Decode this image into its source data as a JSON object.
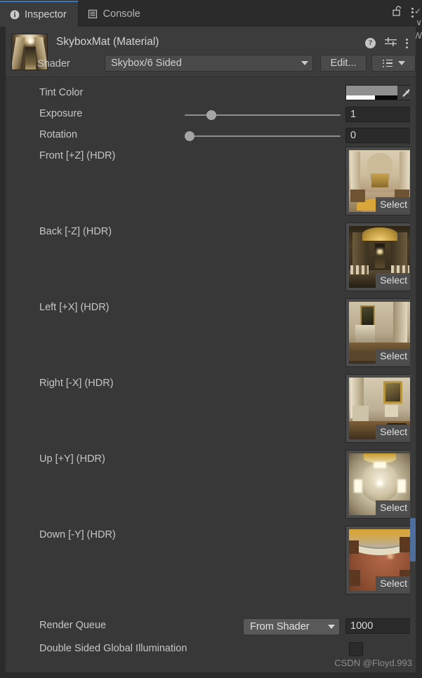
{
  "window": {
    "tabs": [
      {
        "label": "Inspector",
        "icon": "info-icon",
        "active": true
      },
      {
        "label": "Console",
        "icon": "console-list-icon",
        "active": false
      }
    ],
    "lock_icon": "padlock-unlocked-icon",
    "menu_icon": "kebab-menu-icon",
    "edge_peek_letter": "W",
    "edge_check": "✓",
    "edge_v": "∨"
  },
  "material": {
    "title": "SkyboxMat  (Material)",
    "preview_name": "skybox-material-preview",
    "header_icons": [
      {
        "name": "help-icon",
        "glyph": "?"
      },
      {
        "name": "preset-settings-icon"
      },
      {
        "name": "kebab-menu-icon"
      }
    ],
    "shader": {
      "label": "Shader",
      "value": "Skybox/6 Sided",
      "edit_button": "Edit...",
      "presets_button_icon": "shader-variant-list-icon"
    }
  },
  "properties": {
    "tint_color": {
      "label": "Tint Color",
      "swatch_hex": "#8f8f8f",
      "alpha_white_hex": "#ffffff",
      "alpha_black_hex": "#0a0a0a",
      "eyedropper_icon": "eyedropper-icon"
    },
    "exposure": {
      "label": "Exposure",
      "value": "1",
      "slider_percent": 14
    },
    "rotation": {
      "label": "Rotation",
      "value": "0",
      "slider_percent": 0
    },
    "textures": [
      {
        "label": "Front [+Z]   (HDR)",
        "select_label": "Select",
        "slot": "front"
      },
      {
        "label": "Back [-Z]   (HDR)",
        "select_label": "Select",
        "slot": "back"
      },
      {
        "label": "Left [+X]   (HDR)",
        "select_label": "Select",
        "slot": "left"
      },
      {
        "label": "Right [-X]   (HDR)",
        "select_label": "Select",
        "slot": "right"
      },
      {
        "label": "Up [+Y]   (HDR)",
        "select_label": "Select",
        "slot": "up"
      },
      {
        "label": "Down [-Y]   (HDR)",
        "select_label": "Select",
        "slot": "down"
      }
    ],
    "render_queue": {
      "label": "Render Queue",
      "mode": "From Shader",
      "value": "1000"
    },
    "double_sided_gi": {
      "label": "Double Sided Global Illumination",
      "checked": false
    }
  },
  "watermark": "CSDN @Floyd.993",
  "colors": {
    "panel_bg": "#383838",
    "header_bg": "#3c3c3c",
    "window_chrome": "#2b2b2b",
    "accent_blue": "#3a79bb",
    "scrollbar_thumb": "#4c6f9e",
    "text": "#c6c6c6"
  }
}
